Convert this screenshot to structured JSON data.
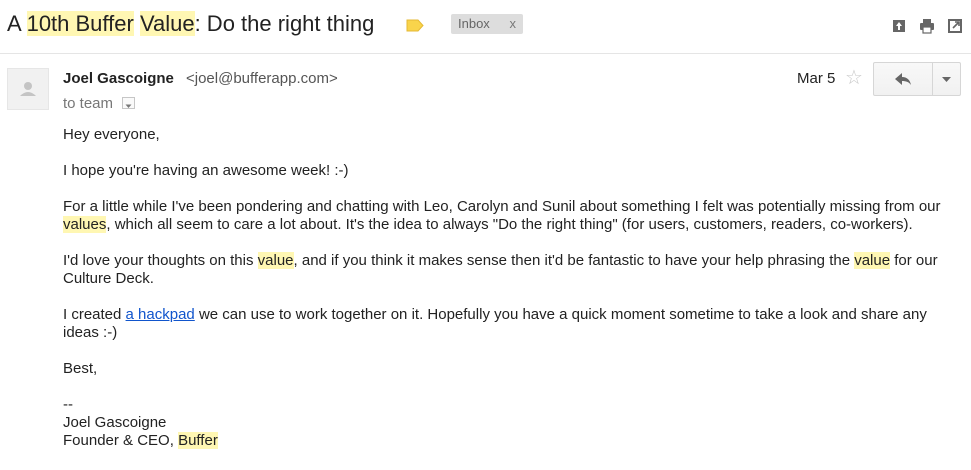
{
  "subject": {
    "p1": "A ",
    "hl1": "10th Buffer",
    "p2": " ",
    "hl2": "Value",
    "p3": ": Do the right thing"
  },
  "label_chip": {
    "label": "Inbox",
    "remove": "x"
  },
  "header_icons": [
    "print-all-icon",
    "print-icon",
    "new-window-icon"
  ],
  "sender": {
    "name": "Joel Gascoigne",
    "email": "<joel@bufferapp.com>",
    "to": "to team",
    "date": "Mar 5"
  },
  "body": {
    "greeting": "Hey everyone,",
    "line1": "I hope you're having an awesome week! :-)",
    "para1": {
      "a": "For a little while I've been pondering and chatting with Leo, Carolyn and Sunil about something I felt was potentially missing from our ",
      "hl": "values",
      "b": ", which all seem to care a lot about. It's the idea to always \"Do the right thing\" (for users, customers, readers, co-workers)."
    },
    "para2": {
      "a": "I'd love your thoughts on this ",
      "hl1": "value",
      "b": ", and if you think it makes sense then it'd be fantastic to have your help phrasing the ",
      "hl2": "value",
      "c": " for our Culture Deck."
    },
    "para3": {
      "a": "I created ",
      "link": "a hackpad",
      "b": " we can use to work together on it. Hopefully you have a quick moment sometime to take a look and share any ideas :-)"
    },
    "closing": "Best,",
    "sig_dash": "--",
    "sig_name": "Joel Gascoigne",
    "sig_title_a": "Founder & CEO, ",
    "sig_title_hl": "Buffer"
  },
  "colors": {
    "highlight": "#fff7b3",
    "label_tag": "#f9d44b",
    "link": "#1155cc",
    "chip_bg": "#dddddd"
  }
}
